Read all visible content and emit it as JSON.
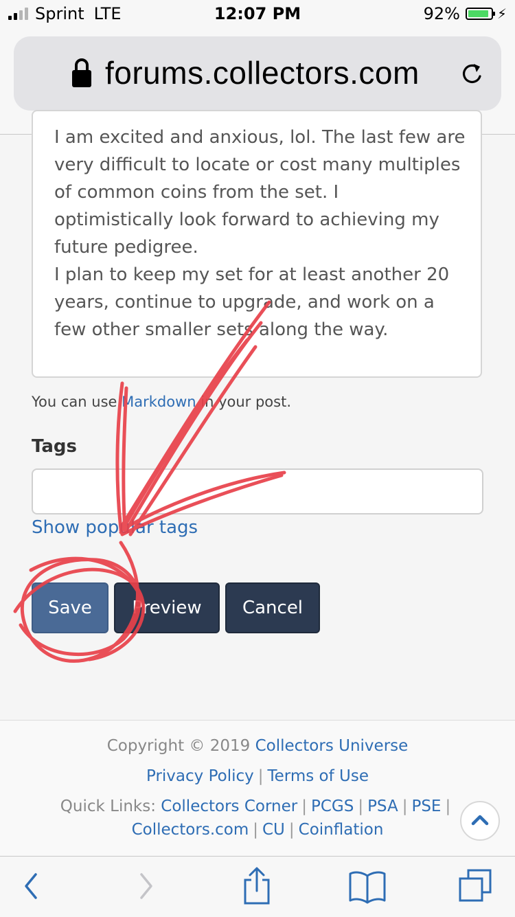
{
  "status_bar": {
    "carrier": "Sprint",
    "network": "LTE",
    "time": "12:07 PM",
    "battery_percent_label": "92%",
    "battery_level": 0.92,
    "signal_bars_active": 2,
    "signal_bars_total": 4
  },
  "browser": {
    "url": "forums.collectors.com"
  },
  "editor": {
    "body_text": "I am excited and anxious, lol. The last few are\nvery difficult to locate or cost many multiples\nof common coins from the set. I\noptimistically look forward to achieving my\nfuture pedigree.\nI plan to keep my set for at least another 20\nyears, continue to upgrade, and work on a\nfew other smaller sets along the way.",
    "hint_prefix": "You can use ",
    "hint_link": "Markdown",
    "hint_suffix": " in your post."
  },
  "tags": {
    "label": "Tags",
    "value": "",
    "show_popular_label": "Show popular tags"
  },
  "actions": {
    "save": "Save",
    "preview": "Preview",
    "cancel": "Cancel"
  },
  "footer": {
    "copyright_prefix": "Copyright © 2019",
    "copyright_link": "Collectors Universe",
    "privacy": "Privacy Policy",
    "terms": "Terms of Use",
    "quick_links_label": "Quick Links:",
    "links_row1": [
      "Collectors Corner",
      "PCGS",
      "PSA",
      "PSE"
    ],
    "links_row2": [
      "Collectors.com",
      "CU",
      "Coinflation"
    ],
    "separator": "|"
  },
  "icons": {
    "lock": "lock-icon",
    "reload": "reload-icon",
    "scroll_top": "chevron-up-icon",
    "back": "chevron-left-icon",
    "forward": "chevron-right-icon",
    "share": "share-icon",
    "bookmarks": "book-icon",
    "tabs": "tabs-icon"
  },
  "colors": {
    "link": "#2e6db4",
    "save_button": "#4a6a96",
    "dark_button": "#2c3a51",
    "annotation": "#e8414a",
    "battery": "#4cd964"
  }
}
